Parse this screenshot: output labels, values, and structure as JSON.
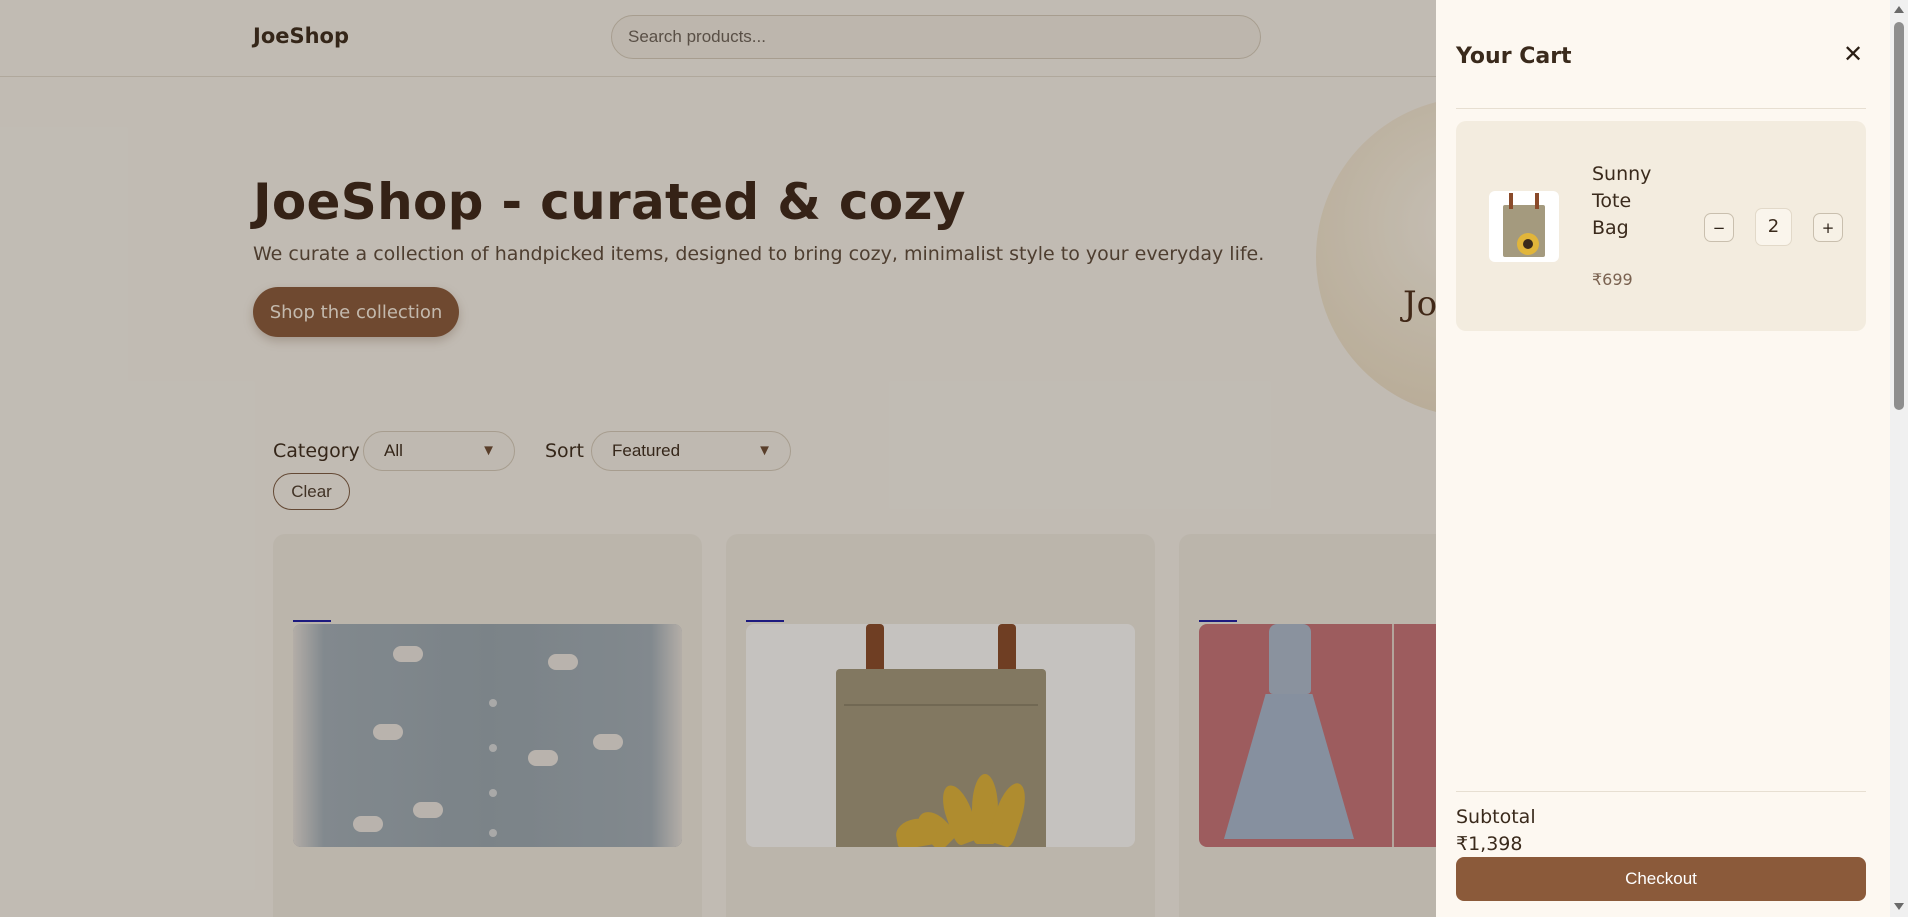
{
  "header": {
    "logo": "JoeShop",
    "search_placeholder": "Search products..."
  },
  "hero": {
    "title": "JoeShop - curated & cozy",
    "subtitle": "We curate a collection of handpicked items, designed to bring cozy, minimalist style to your everyday life.",
    "cta_label": "Shop the collection",
    "circle_text": "Jo"
  },
  "filters": {
    "category_label": "Category",
    "category_value": "All",
    "sort_label": "Sort",
    "sort_value": "Featured",
    "clear_label": "Clear"
  },
  "products": [
    {
      "image": "cloud-cardigan"
    },
    {
      "image": "sunflower-tote-bag"
    },
    {
      "image": "blue-dress"
    }
  ],
  "cart": {
    "title": "Your Cart",
    "close_icon": "close-icon",
    "items": [
      {
        "name": "Sunny Tote Bag",
        "price": "₹699",
        "quantity": "2",
        "decrement_label": "−",
        "increment_label": "+"
      }
    ],
    "subtotal_label": "Subtotal",
    "subtotal_value": "₹1,398",
    "checkout_label": "Checkout"
  },
  "colors": {
    "accent": "#8b5a3a",
    "background": "#faf6ef",
    "drawer": "#fdf8f1"
  }
}
